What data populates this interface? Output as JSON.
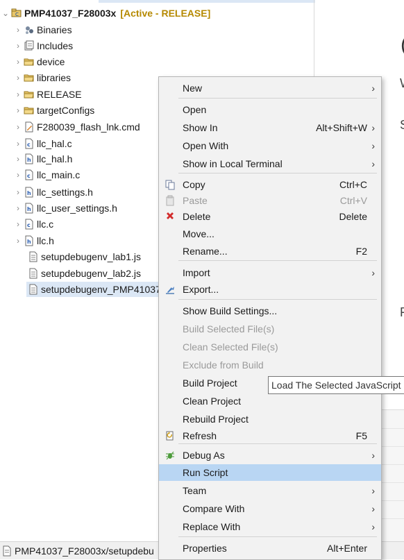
{
  "explorer": {
    "project": {
      "name": "PMP41037_F28003x",
      "tag": "[Active - RELEASE]"
    },
    "items": [
      {
        "label": "Binaries",
        "icon": "binaries-icon"
      },
      {
        "label": "Includes",
        "icon": "includes-icon"
      },
      {
        "label": "device",
        "icon": "folder-icon"
      },
      {
        "label": "libraries",
        "icon": "folder-icon"
      },
      {
        "label": "RELEASE",
        "icon": "folder-icon"
      },
      {
        "label": "targetConfigs",
        "icon": "folder-icon"
      },
      {
        "label": "F280039_flash_lnk.cmd",
        "icon": "cmd-file-icon"
      },
      {
        "label": "llc_hal.c",
        "icon": "c-file-icon"
      },
      {
        "label": "llc_hal.h",
        "icon": "h-file-icon"
      },
      {
        "label": "llc_main.c",
        "icon": "c-file-icon"
      },
      {
        "label": "llc_settings.h",
        "icon": "h-file-icon"
      },
      {
        "label": "llc_user_settings.h",
        "icon": "h-file-icon"
      },
      {
        "label": "llc.c",
        "icon": "c-file-icon"
      },
      {
        "label": "llc.h",
        "icon": "h-file-icon"
      },
      {
        "label": "setupdebugenv_lab1.js",
        "icon": "text-file-icon"
      },
      {
        "label": "setupdebugenv_lab2.js",
        "icon": "text-file-icon"
      },
      {
        "label": "setupdebugenv_PMP41037",
        "icon": "text-file-icon"
      }
    ]
  },
  "editor_fragments": {
    "big": "(",
    "w": "W",
    "s": "S",
    "r": "F"
  },
  "context_menu": {
    "items": [
      {
        "label": "New",
        "submenu": true
      },
      {
        "label": "Open"
      },
      {
        "label": "Show In",
        "shortcut": "Alt+Shift+W",
        "submenu": true
      },
      {
        "label": "Open With",
        "submenu": true
      },
      {
        "label": "Show in Local Terminal",
        "submenu": true
      },
      {
        "label": "Copy",
        "shortcut": "Ctrl+C",
        "icon": "copy-icon"
      },
      {
        "label": "Paste",
        "shortcut": "Ctrl+V",
        "icon": "paste-icon",
        "disabled": true
      },
      {
        "label": "Delete",
        "shortcut": "Delete",
        "icon": "delete-icon"
      },
      {
        "label": "Move..."
      },
      {
        "label": "Rename...",
        "shortcut": "F2"
      },
      {
        "label": "Import",
        "submenu": true
      },
      {
        "label": "Export...",
        "icon": "export-icon"
      },
      {
        "label": "Show Build Settings..."
      },
      {
        "label": "Build Selected File(s)",
        "disabled": true
      },
      {
        "label": "Clean Selected File(s)",
        "disabled": true
      },
      {
        "label": "Exclude from Build",
        "disabled": true
      },
      {
        "label": "Build Project"
      },
      {
        "label": "Clean Project"
      },
      {
        "label": "Rebuild Project"
      },
      {
        "label": "Refresh",
        "shortcut": "F5",
        "icon": "refresh-icon"
      },
      {
        "label": "Debug As",
        "submenu": true,
        "icon": "debug-icon"
      },
      {
        "label": "Run Script",
        "highlighted": true
      },
      {
        "label": "Team",
        "submenu": true
      },
      {
        "label": "Compare With",
        "submenu": true
      },
      {
        "label": "Replace With",
        "submenu": true
      },
      {
        "label": "Properties",
        "shortcut": "Alt+Enter"
      }
    ]
  },
  "tooltip": {
    "text": "Load The Selected JavaScript"
  },
  "statusbar": {
    "text": "PMP41037_F28003x/setupdebu"
  },
  "colors": {
    "selection": "#dbe7f5",
    "menu_highlight": "#b9d6f3",
    "menu_background": "#f2f2f2",
    "project_tag": "#b58900"
  }
}
